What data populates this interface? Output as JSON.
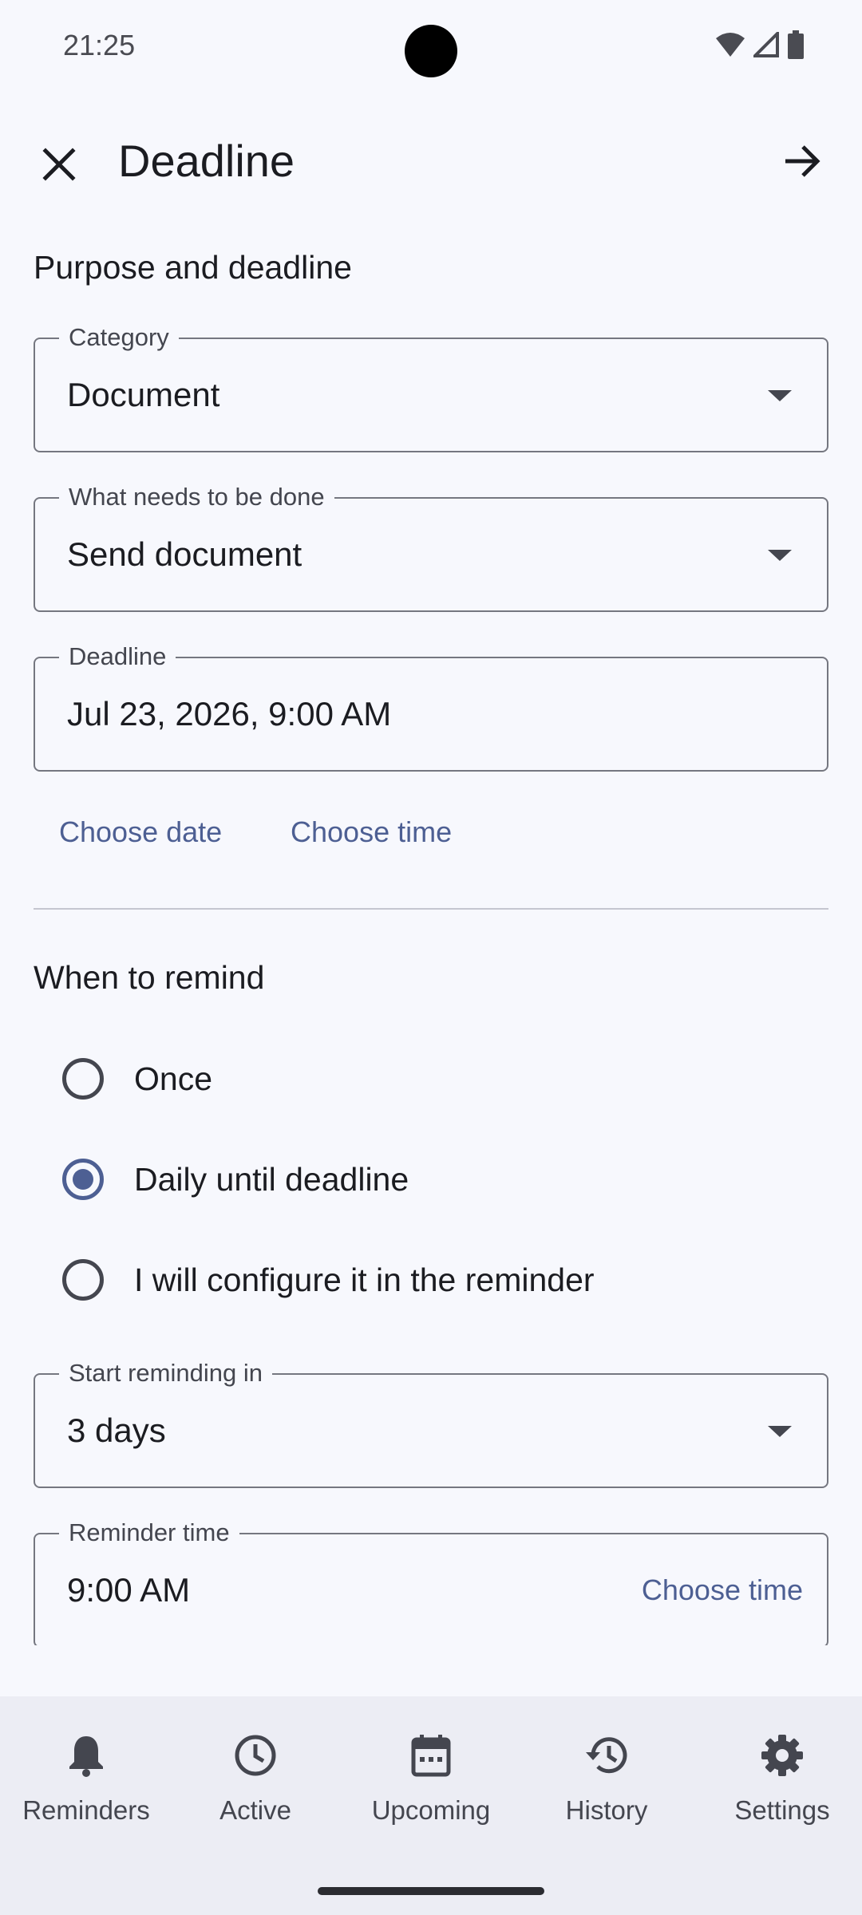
{
  "status_bar": {
    "time": "21:25"
  },
  "app_bar": {
    "title": "Deadline"
  },
  "purpose_section": {
    "title": "Purpose and deadline",
    "category": {
      "label": "Category",
      "value": "Document"
    },
    "task": {
      "label": "What needs to be done",
      "value": "Send document"
    },
    "deadline": {
      "label": "Deadline",
      "value": "Jul 23, 2026, 9:00 AM"
    },
    "choose_date": "Choose date",
    "choose_time": "Choose time"
  },
  "remind_section": {
    "title": "When to remind",
    "options": [
      {
        "label": "Once",
        "checked": false
      },
      {
        "label": "Daily until deadline",
        "checked": true
      },
      {
        "label": "I will configure it in the reminder",
        "checked": false
      }
    ],
    "start_reminding": {
      "label": "Start reminding in",
      "value": "3 days"
    },
    "reminder_time": {
      "label": "Reminder time",
      "value": "9:00 AM",
      "action": "Choose time"
    }
  },
  "bottom_nav": {
    "items": [
      {
        "label": "Reminders",
        "icon": "bell-icon"
      },
      {
        "label": "Active",
        "icon": "clock-icon"
      },
      {
        "label": "Upcoming",
        "icon": "calendar-icon"
      },
      {
        "label": "History",
        "icon": "history-icon"
      },
      {
        "label": "Settings",
        "icon": "gear-icon"
      }
    ]
  },
  "colors": {
    "accent": "#4d5f93",
    "background": "#f7f8fd",
    "nav_background": "#ecedf4",
    "outline": "#757780"
  }
}
